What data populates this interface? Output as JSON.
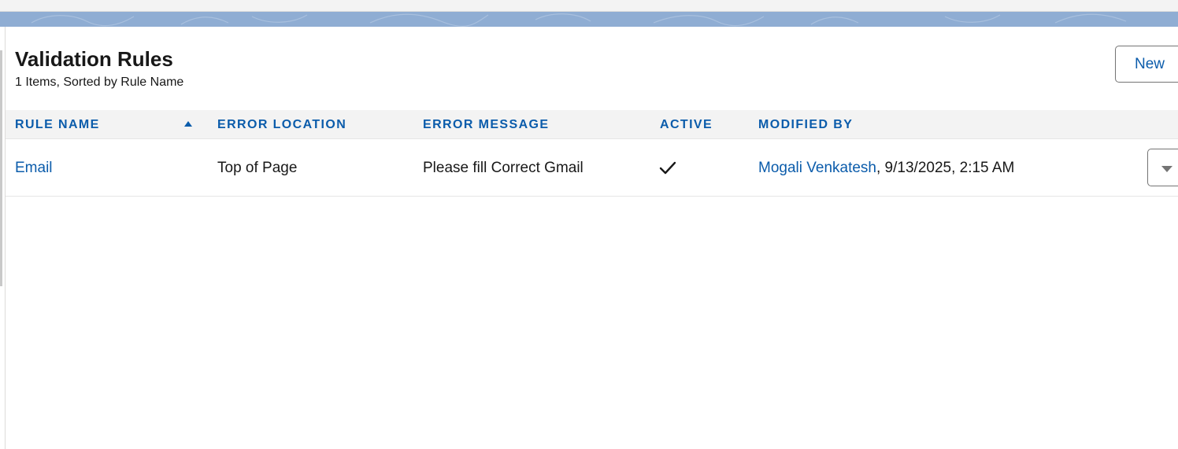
{
  "page": {
    "title": "Validation Rules",
    "subtitle": "1 Items, Sorted by Rule Name",
    "new_button_label": "New"
  },
  "table": {
    "columns": [
      "RULE NAME",
      "ERROR LOCATION",
      "ERROR MESSAGE",
      "ACTIVE",
      "MODIFIED BY"
    ],
    "sorted_column": "RULE NAME",
    "sort_direction": "ascending",
    "rows": [
      {
        "rule_name": "Email",
        "error_location": "Top of Page",
        "error_message": "Please fill Correct Gmail",
        "active": true,
        "modified_by_user": "Mogali Venkatesh",
        "modified_by_date": ", 9/13/2025, 2:15 AM"
      }
    ]
  },
  "icons": {
    "sort": "arrow-up-icon",
    "active": "checkmark-icon",
    "row_actions": "chevron-down-icon"
  },
  "colors": {
    "link": "#0b5cab",
    "header_bg": "#f3f3f3",
    "banner": "#8fadd3"
  }
}
